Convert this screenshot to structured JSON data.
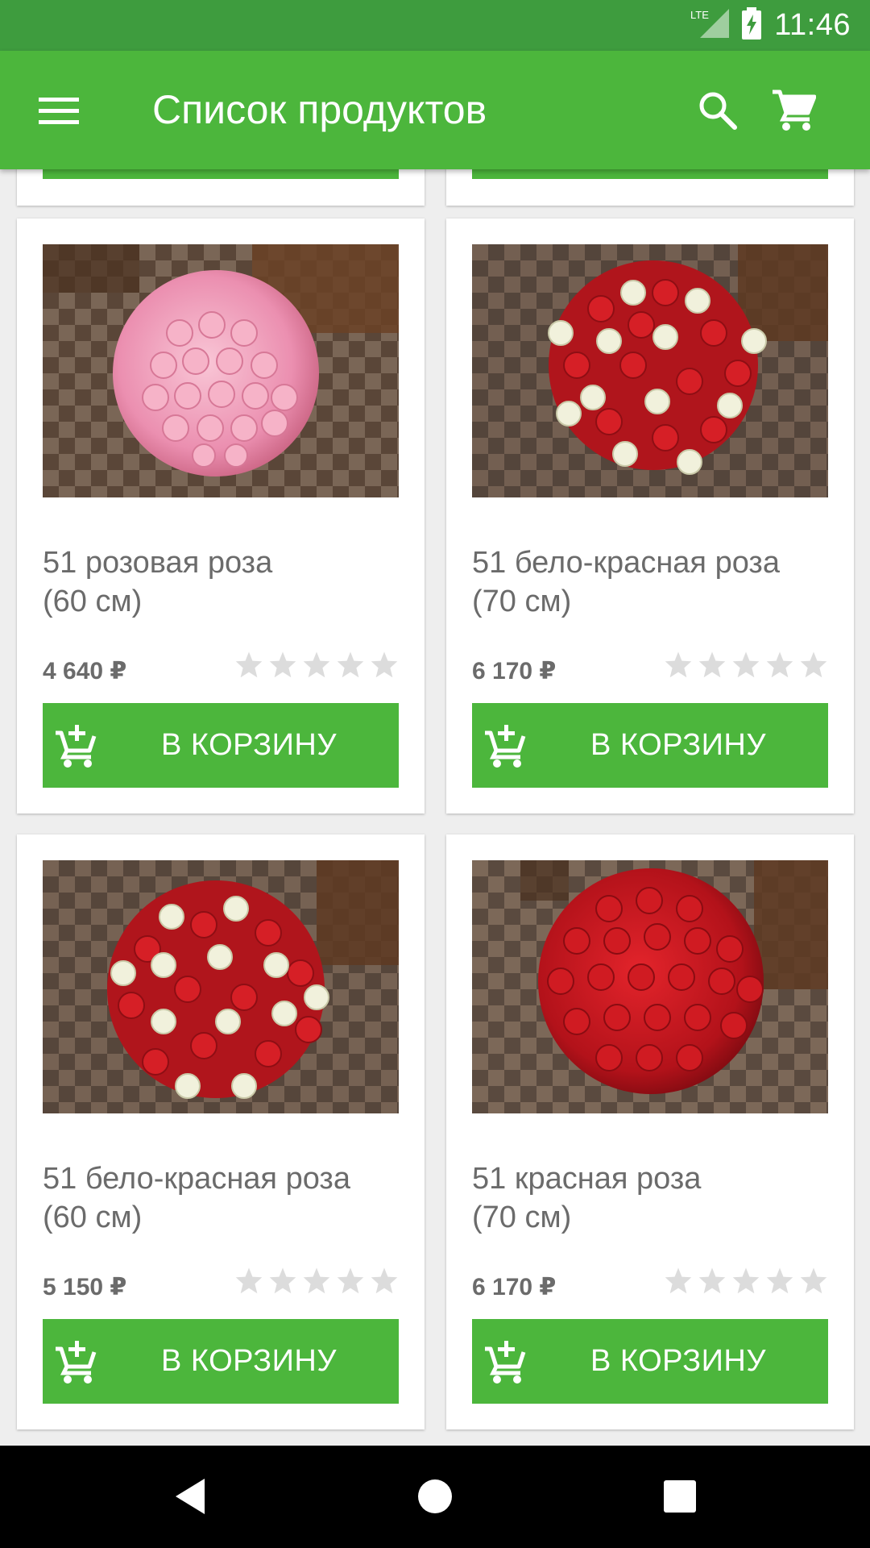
{
  "status_bar": {
    "network": "LTE",
    "time": "11:46"
  },
  "app_bar": {
    "title": "Список продуктов",
    "menu_icon": "menu-icon",
    "search_icon": "search-icon",
    "cart_icon": "cart-icon"
  },
  "products": [
    {
      "name_line1": "51 розовая роза",
      "name_line2": "(60 см)",
      "price": "4 640 ₽",
      "rating": 0,
      "max_rating": 5,
      "button_label": "В КОРЗИНУ"
    },
    {
      "name_line1": "51 бело-красная роза",
      "name_line2": "(70 см)",
      "price": "6 170 ₽",
      "rating": 0,
      "max_rating": 5,
      "button_label": "В КОРЗИНУ"
    },
    {
      "name_line1": "51 бело-красная роза",
      "name_line2": "(60 см)",
      "price": "5 150 ₽",
      "rating": 0,
      "max_rating": 5,
      "button_label": "В КОРЗИНУ"
    },
    {
      "name_line1": "51 красная роза",
      "name_line2": "(70 см)",
      "price": "6 170 ₽",
      "rating": 0,
      "max_rating": 5,
      "button_label": "В КОРЗИНУ"
    }
  ],
  "colors": {
    "status_bar": "#3e9c3e",
    "app_bar": "#4cb63c",
    "button": "#4cb63c",
    "background": "#eeeeee",
    "text_secondary": "#6b6b6b",
    "star_empty": "#dcdcdc"
  },
  "nav_bar": {
    "back_icon": "back-triangle-icon",
    "home_icon": "home-circle-icon",
    "recents_icon": "recents-square-icon"
  }
}
